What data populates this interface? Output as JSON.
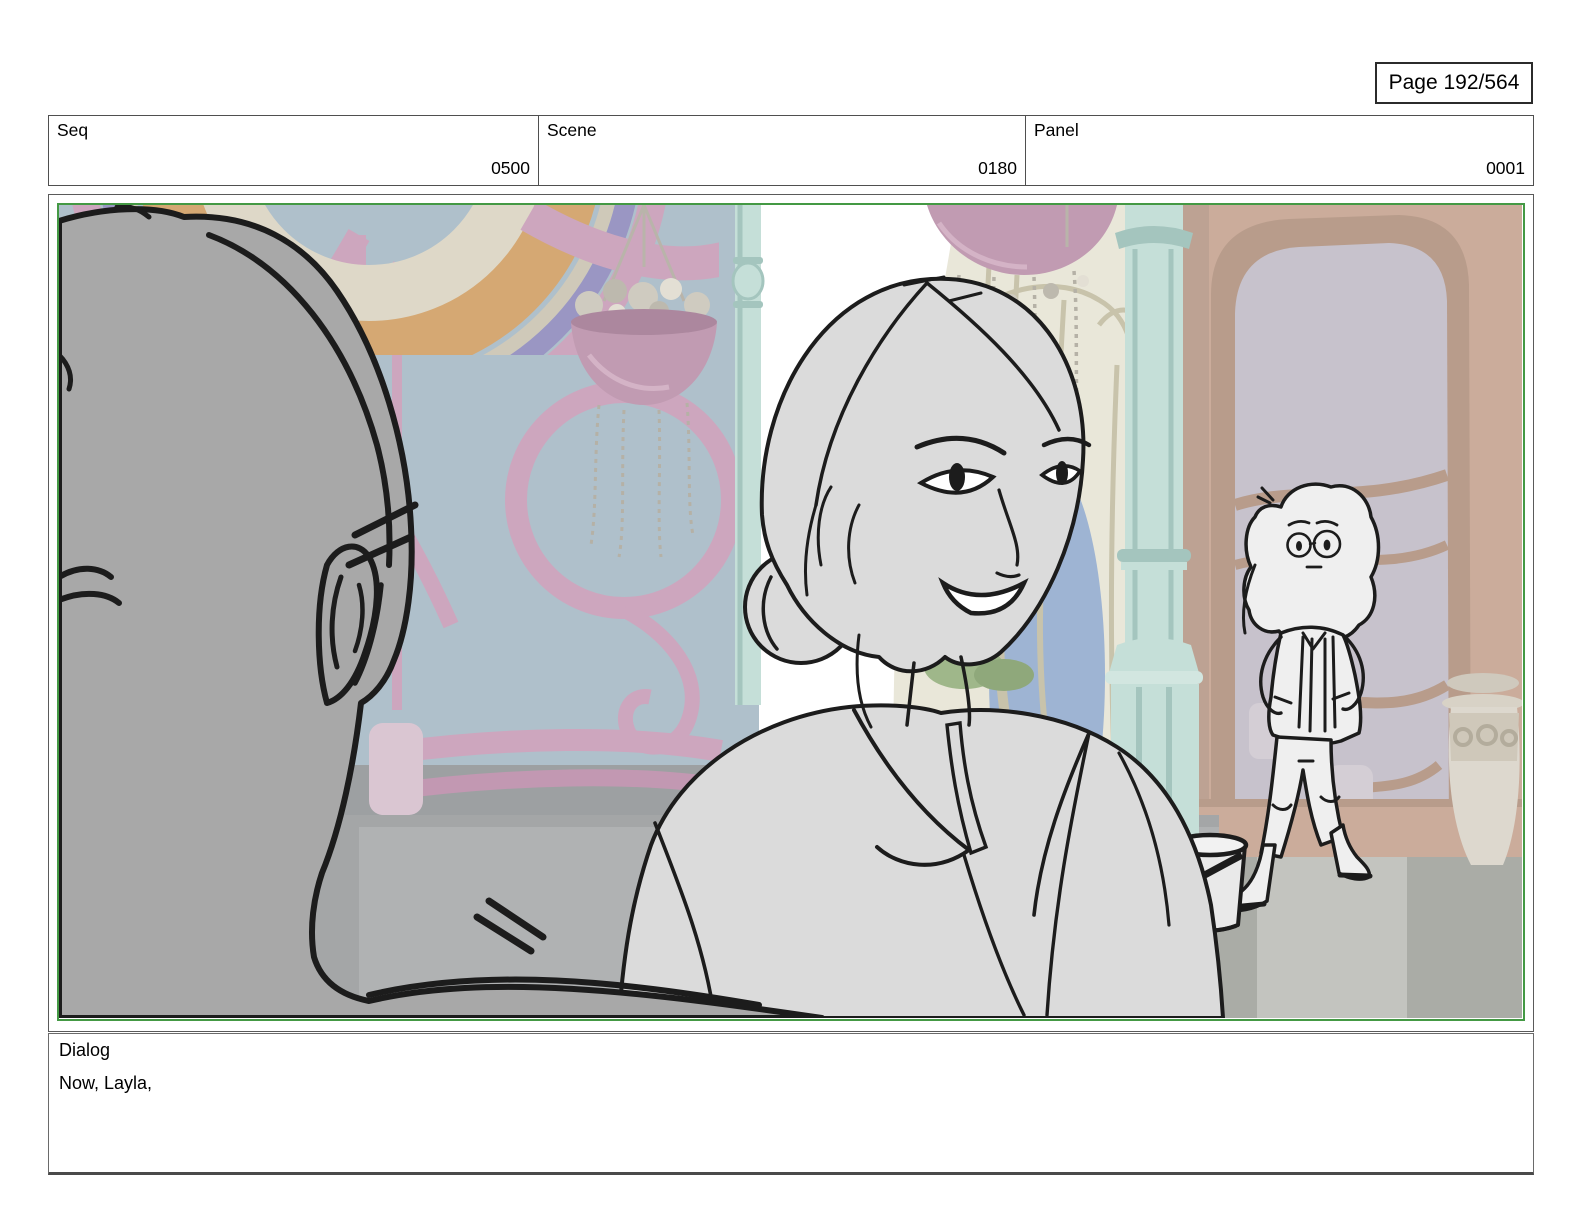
{
  "page": {
    "indicator": "Page 192/564"
  },
  "header": {
    "columns": [
      {
        "label": "Seq",
        "value": "0500"
      },
      {
        "label": "Scene",
        "value": "0180"
      },
      {
        "label": "Panel",
        "value": "0001"
      }
    ]
  },
  "dialog": {
    "label": "Dialog",
    "line": "Now, Layla,"
  },
  "colors": {
    "frame-green": "#449944",
    "chrome-border": "#4f4f4f",
    "ink": "#1c1c1c",
    "window-blue": "#afc0cb",
    "lattice-pink": "#cda6be",
    "lattice-pink-dark": "#c298b2",
    "pale-pink": "#dac6d2",
    "teal": "#c5dfd8",
    "teal-shade": "#a4c5be",
    "cream": "#e9e7d9",
    "cream-line": "#c8c3ab",
    "glass-blue": "#9eb4d3",
    "tan-wall": "#cbac9b",
    "tan-dark": "#b89c8b",
    "mirror": "#c7c2cc",
    "mirror-light": "#d4ced5",
    "wall-gray": "#9da0a2",
    "floor-gray": "#a4a6a7",
    "floor-light": "#c3c4bf",
    "counter-gray": "#b0b2b3",
    "figure-gray": "#a8a8a8",
    "woman-gray": "#dbdbdb",
    "girl-white": "#efefef",
    "mauve-pot": "#c19bb2",
    "pot-dark": "#ac879e",
    "flower-gray": "#cfcbc0",
    "leaf-green": "#9fb78a",
    "fan-orange": "#d5a873",
    "fan-purple": "#9a96c3"
  }
}
